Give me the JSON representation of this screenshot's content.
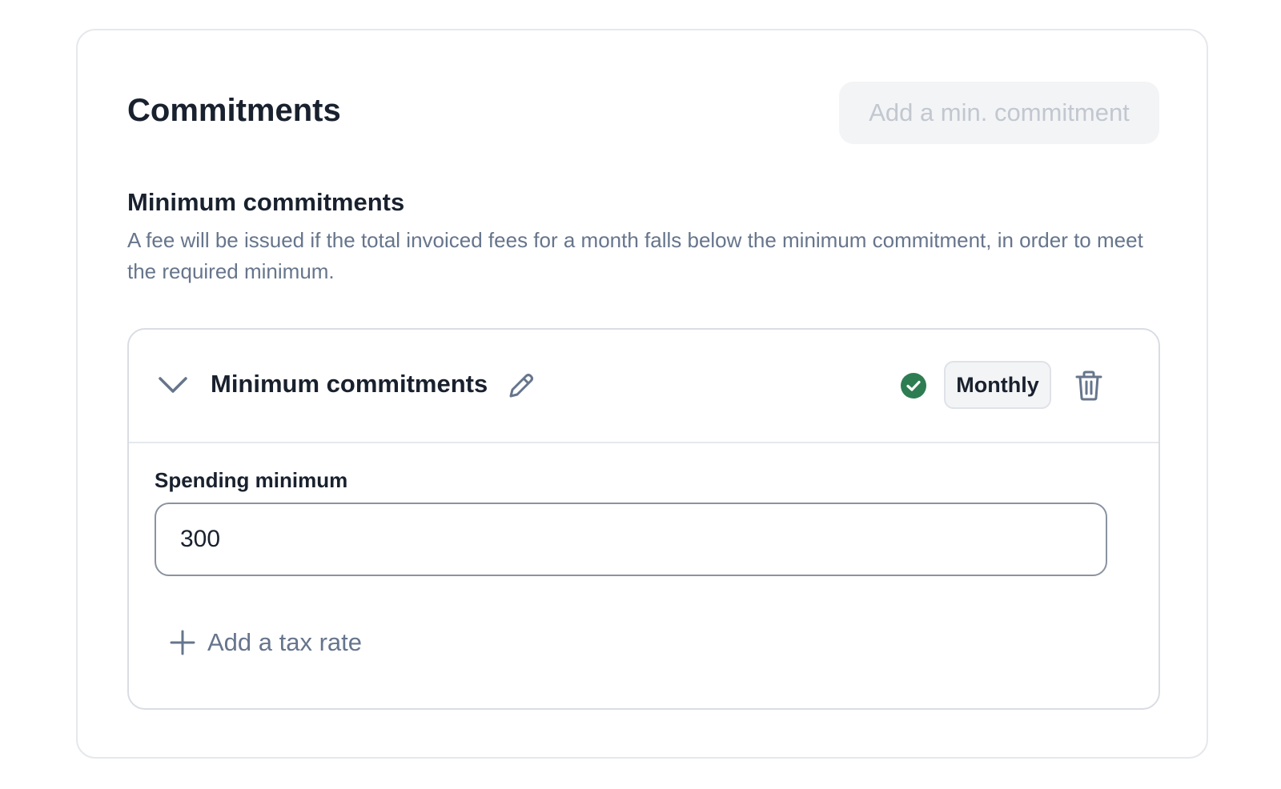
{
  "card": {
    "title": "Commitments",
    "add_button_label": "Add a min. commitment"
  },
  "section": {
    "title": "Minimum commitments",
    "description": "A fee will be issued if the total invoiced fees for a month falls below the minimum commitment, in order to meet the required minimum."
  },
  "commitment": {
    "title": "Minimum commitments",
    "status": "valid",
    "interval": "Monthly",
    "field_label": "Spending minimum",
    "amount_value": "300",
    "add_tax_label": "Add a tax rate"
  },
  "icons": {
    "collapse": "chevron-down-icon",
    "edit": "pencil-icon",
    "status": "check-circle-icon",
    "delete": "trash-icon",
    "add": "plus-icon"
  },
  "colors": {
    "status_green": "#2e7d52",
    "text_primary": "#19212e",
    "text_secondary": "#66758c",
    "disabled_text": "#c2c7d0",
    "disabled_bg": "#f3f4f6"
  }
}
